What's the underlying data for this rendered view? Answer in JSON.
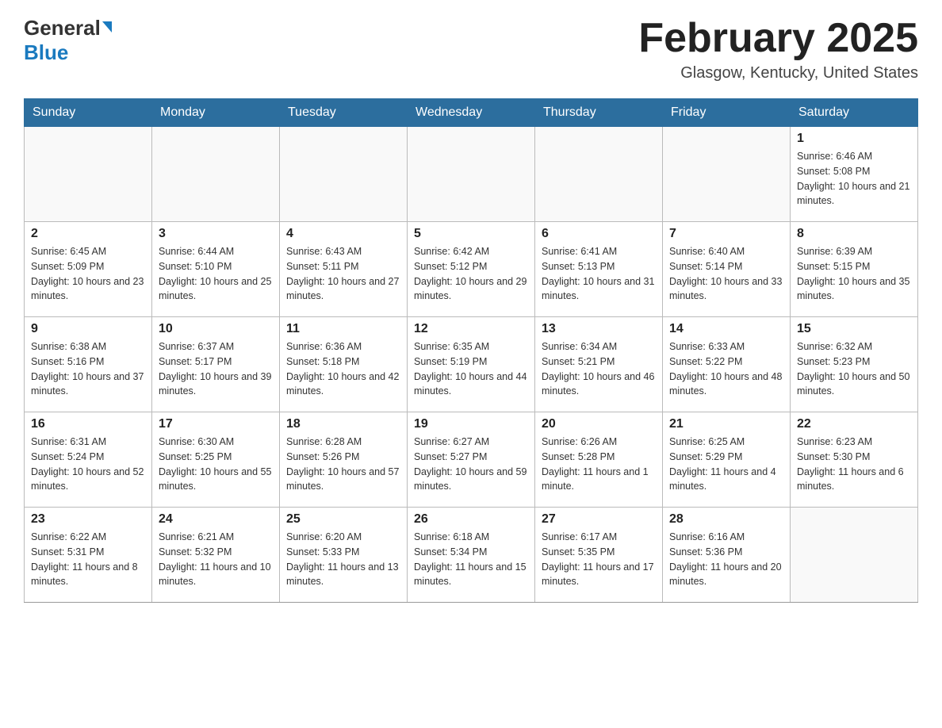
{
  "header": {
    "logo_general": "General",
    "logo_blue": "Blue",
    "month_title": "February 2025",
    "location": "Glasgow, Kentucky, United States"
  },
  "days_of_week": [
    "Sunday",
    "Monday",
    "Tuesday",
    "Wednesday",
    "Thursday",
    "Friday",
    "Saturday"
  ],
  "weeks": [
    [
      {
        "day": "",
        "sunrise": "",
        "sunset": "",
        "daylight": ""
      },
      {
        "day": "",
        "sunrise": "",
        "sunset": "",
        "daylight": ""
      },
      {
        "day": "",
        "sunrise": "",
        "sunset": "",
        "daylight": ""
      },
      {
        "day": "",
        "sunrise": "",
        "sunset": "",
        "daylight": ""
      },
      {
        "day": "",
        "sunrise": "",
        "sunset": "",
        "daylight": ""
      },
      {
        "day": "",
        "sunrise": "",
        "sunset": "",
        "daylight": ""
      },
      {
        "day": "1",
        "sunrise": "Sunrise: 6:46 AM",
        "sunset": "Sunset: 5:08 PM",
        "daylight": "Daylight: 10 hours and 21 minutes."
      }
    ],
    [
      {
        "day": "2",
        "sunrise": "Sunrise: 6:45 AM",
        "sunset": "Sunset: 5:09 PM",
        "daylight": "Daylight: 10 hours and 23 minutes."
      },
      {
        "day": "3",
        "sunrise": "Sunrise: 6:44 AM",
        "sunset": "Sunset: 5:10 PM",
        "daylight": "Daylight: 10 hours and 25 minutes."
      },
      {
        "day": "4",
        "sunrise": "Sunrise: 6:43 AM",
        "sunset": "Sunset: 5:11 PM",
        "daylight": "Daylight: 10 hours and 27 minutes."
      },
      {
        "day": "5",
        "sunrise": "Sunrise: 6:42 AM",
        "sunset": "Sunset: 5:12 PM",
        "daylight": "Daylight: 10 hours and 29 minutes."
      },
      {
        "day": "6",
        "sunrise": "Sunrise: 6:41 AM",
        "sunset": "Sunset: 5:13 PM",
        "daylight": "Daylight: 10 hours and 31 minutes."
      },
      {
        "day": "7",
        "sunrise": "Sunrise: 6:40 AM",
        "sunset": "Sunset: 5:14 PM",
        "daylight": "Daylight: 10 hours and 33 minutes."
      },
      {
        "day": "8",
        "sunrise": "Sunrise: 6:39 AM",
        "sunset": "Sunset: 5:15 PM",
        "daylight": "Daylight: 10 hours and 35 minutes."
      }
    ],
    [
      {
        "day": "9",
        "sunrise": "Sunrise: 6:38 AM",
        "sunset": "Sunset: 5:16 PM",
        "daylight": "Daylight: 10 hours and 37 minutes."
      },
      {
        "day": "10",
        "sunrise": "Sunrise: 6:37 AM",
        "sunset": "Sunset: 5:17 PM",
        "daylight": "Daylight: 10 hours and 39 minutes."
      },
      {
        "day": "11",
        "sunrise": "Sunrise: 6:36 AM",
        "sunset": "Sunset: 5:18 PM",
        "daylight": "Daylight: 10 hours and 42 minutes."
      },
      {
        "day": "12",
        "sunrise": "Sunrise: 6:35 AM",
        "sunset": "Sunset: 5:19 PM",
        "daylight": "Daylight: 10 hours and 44 minutes."
      },
      {
        "day": "13",
        "sunrise": "Sunrise: 6:34 AM",
        "sunset": "Sunset: 5:21 PM",
        "daylight": "Daylight: 10 hours and 46 minutes."
      },
      {
        "day": "14",
        "sunrise": "Sunrise: 6:33 AM",
        "sunset": "Sunset: 5:22 PM",
        "daylight": "Daylight: 10 hours and 48 minutes."
      },
      {
        "day": "15",
        "sunrise": "Sunrise: 6:32 AM",
        "sunset": "Sunset: 5:23 PM",
        "daylight": "Daylight: 10 hours and 50 minutes."
      }
    ],
    [
      {
        "day": "16",
        "sunrise": "Sunrise: 6:31 AM",
        "sunset": "Sunset: 5:24 PM",
        "daylight": "Daylight: 10 hours and 52 minutes."
      },
      {
        "day": "17",
        "sunrise": "Sunrise: 6:30 AM",
        "sunset": "Sunset: 5:25 PM",
        "daylight": "Daylight: 10 hours and 55 minutes."
      },
      {
        "day": "18",
        "sunrise": "Sunrise: 6:28 AM",
        "sunset": "Sunset: 5:26 PM",
        "daylight": "Daylight: 10 hours and 57 minutes."
      },
      {
        "day": "19",
        "sunrise": "Sunrise: 6:27 AM",
        "sunset": "Sunset: 5:27 PM",
        "daylight": "Daylight: 10 hours and 59 minutes."
      },
      {
        "day": "20",
        "sunrise": "Sunrise: 6:26 AM",
        "sunset": "Sunset: 5:28 PM",
        "daylight": "Daylight: 11 hours and 1 minute."
      },
      {
        "day": "21",
        "sunrise": "Sunrise: 6:25 AM",
        "sunset": "Sunset: 5:29 PM",
        "daylight": "Daylight: 11 hours and 4 minutes."
      },
      {
        "day": "22",
        "sunrise": "Sunrise: 6:23 AM",
        "sunset": "Sunset: 5:30 PM",
        "daylight": "Daylight: 11 hours and 6 minutes."
      }
    ],
    [
      {
        "day": "23",
        "sunrise": "Sunrise: 6:22 AM",
        "sunset": "Sunset: 5:31 PM",
        "daylight": "Daylight: 11 hours and 8 minutes."
      },
      {
        "day": "24",
        "sunrise": "Sunrise: 6:21 AM",
        "sunset": "Sunset: 5:32 PM",
        "daylight": "Daylight: 11 hours and 10 minutes."
      },
      {
        "day": "25",
        "sunrise": "Sunrise: 6:20 AM",
        "sunset": "Sunset: 5:33 PM",
        "daylight": "Daylight: 11 hours and 13 minutes."
      },
      {
        "day": "26",
        "sunrise": "Sunrise: 6:18 AM",
        "sunset": "Sunset: 5:34 PM",
        "daylight": "Daylight: 11 hours and 15 minutes."
      },
      {
        "day": "27",
        "sunrise": "Sunrise: 6:17 AM",
        "sunset": "Sunset: 5:35 PM",
        "daylight": "Daylight: 11 hours and 17 minutes."
      },
      {
        "day": "28",
        "sunrise": "Sunrise: 6:16 AM",
        "sunset": "Sunset: 5:36 PM",
        "daylight": "Daylight: 11 hours and 20 minutes."
      },
      {
        "day": "",
        "sunrise": "",
        "sunset": "",
        "daylight": ""
      }
    ]
  ]
}
